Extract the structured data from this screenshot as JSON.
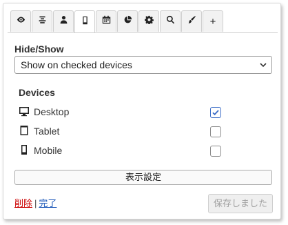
{
  "tabs": [
    {
      "icon": "eye-icon"
    },
    {
      "icon": "align-center-icon"
    },
    {
      "icon": "user-icon"
    },
    {
      "icon": "mobile-device-icon",
      "active": true
    },
    {
      "icon": "calendar-icon"
    },
    {
      "icon": "pie-chart-icon"
    },
    {
      "icon": "gear-icon"
    },
    {
      "icon": "search-icon"
    },
    {
      "icon": "brush-icon"
    },
    {
      "icon": "plus-icon",
      "label": "+"
    }
  ],
  "visibility": {
    "label": "Hide/Show",
    "select_value": "Show on checked devices"
  },
  "devices": {
    "title": "Devices",
    "items": [
      {
        "label": "Desktop",
        "icon": "desktop-icon",
        "checked": true
      },
      {
        "label": "Tablet",
        "icon": "tablet-icon",
        "checked": false
      },
      {
        "label": "Mobile",
        "icon": "mobile-icon",
        "checked": false
      }
    ]
  },
  "display_settings_label": "表示設定",
  "footer": {
    "delete_label": "削除",
    "separator": "|",
    "done_label": "完了",
    "saved_label": "保存しました"
  },
  "colors": {
    "checkbox_accent": "#3b6cc7",
    "delete_link": "#cc0000",
    "done_link": "#1a56b8"
  }
}
